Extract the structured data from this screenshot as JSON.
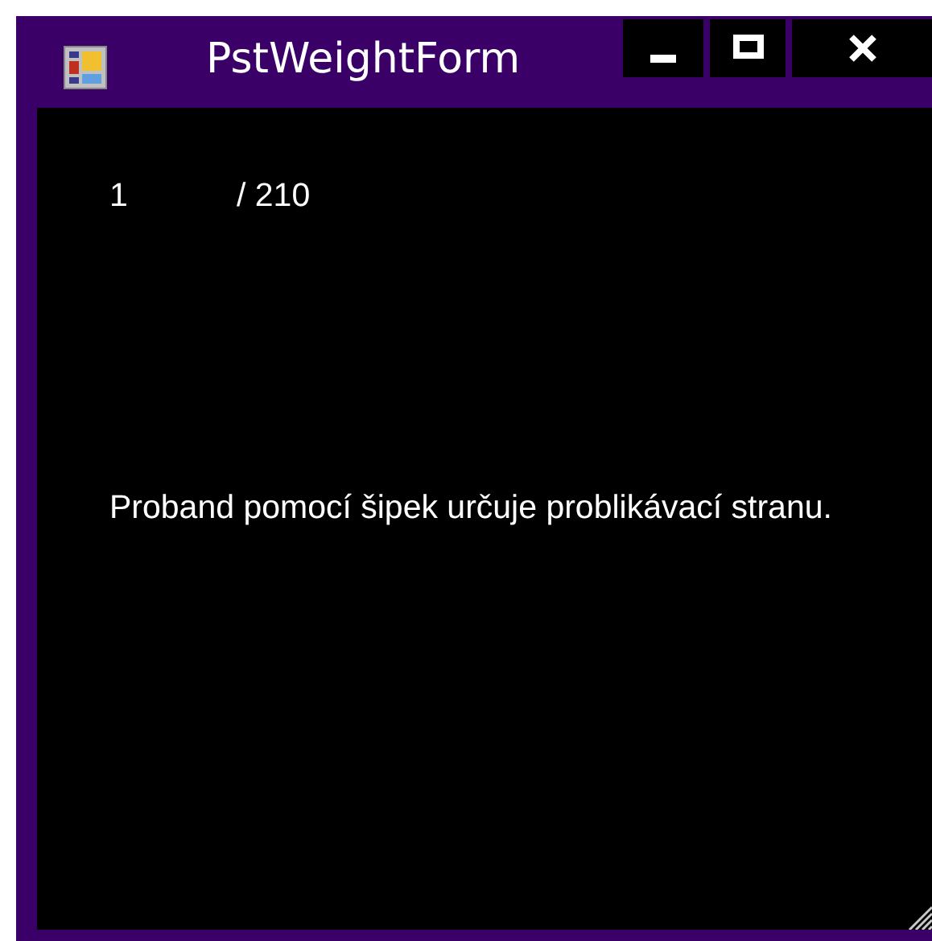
{
  "window": {
    "title": "PstWeightForm"
  },
  "counter": {
    "current": "1",
    "total": "/ 210"
  },
  "instruction": "Proband pomocí šipek určuje problikávací stranu."
}
